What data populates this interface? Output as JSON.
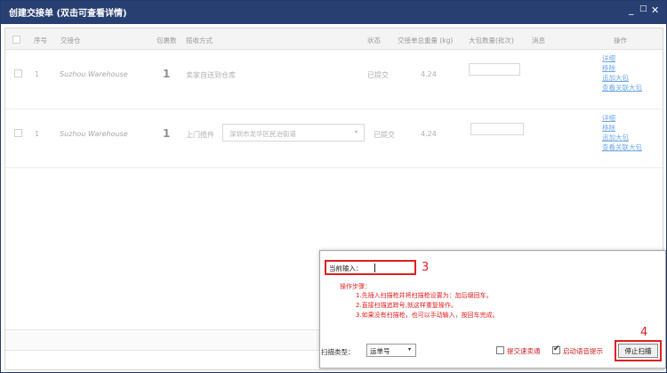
{
  "window": {
    "title": "创建交接单 (双击可查看详情)",
    "controls": {
      "minimize": "_",
      "maximize": "□",
      "close": "✕"
    }
  },
  "table": {
    "headers": {
      "index": "序号",
      "warehouse": "交接仓",
      "parcels": "包裹数",
      "method": "揽收方式",
      "status": "状态",
      "weight": "交接单总重量 (kg)",
      "bags": "大包数量(批次)",
      "message": "消息",
      "actions": "操作"
    },
    "rows": [
      {
        "index": "1",
        "warehouse": "Suzhou Warehouse",
        "parcels": "1",
        "method": "卖家自送到仓库",
        "address": "",
        "status": "已提交",
        "weight": "4.24",
        "actions": [
          "详细",
          "移除",
          "追加大包",
          "查看关联大包"
        ]
      },
      {
        "index": "1",
        "warehouse": "Suzhou Warehouse",
        "parcels": "1",
        "method": "上门揽件",
        "address": "深圳市龙华区民治街道",
        "status": "已提交",
        "weight": "4.24",
        "actions": [
          "详细",
          "移除",
          "追加大包",
          "查看关联大包"
        ]
      }
    ]
  },
  "scan_dialog": {
    "current_input_label": "当前输入：",
    "current_input_value": "",
    "annotation_input": "3",
    "annotation_stop": "4",
    "steps_title": "操作步骤：",
    "steps": [
      "1.先插入扫描枪并将扫描枪设置为：加后缀回车。",
      "2.直接扫描追踪号,就这样重复操作。",
      "3.如果没有扫描枪，也可以手动输入，按回车完成。"
    ],
    "scan_type_label": "扫描类型：",
    "scan_type_value": "运单号",
    "express_label": "提交速卖通",
    "express_checked": false,
    "voice_label": "启动语音提示",
    "voice_checked": true,
    "stop_button": "停止扫描"
  },
  "colors": {
    "titlebar": "#283f72",
    "annotation_red": "#e02020",
    "link_blue": "#6fa8e8"
  }
}
